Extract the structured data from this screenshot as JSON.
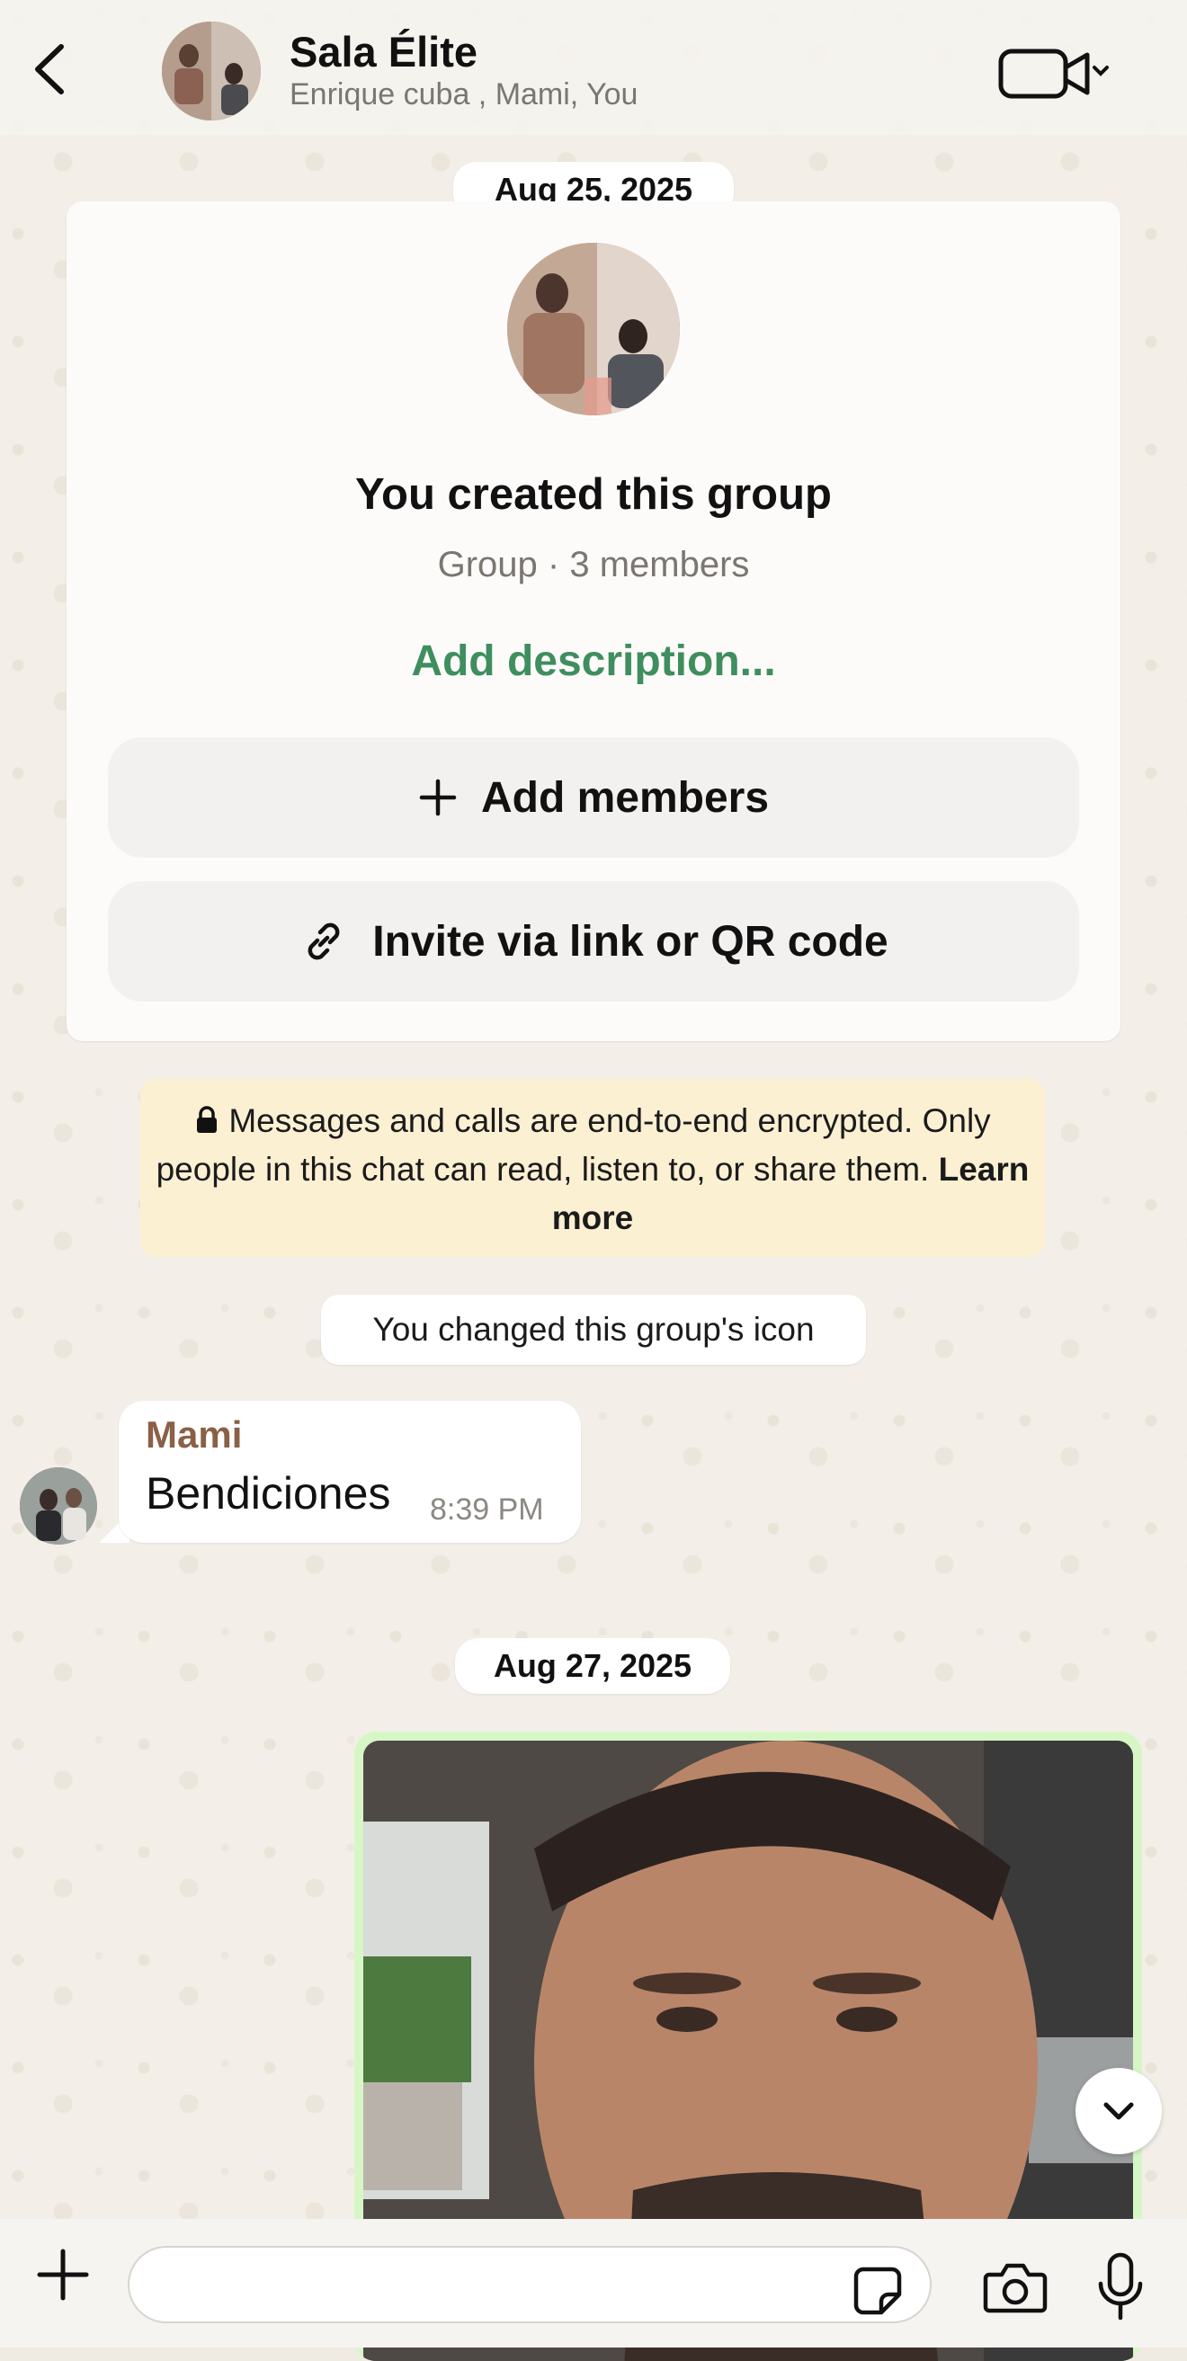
{
  "header": {
    "title": "Sala Élite",
    "subtitle": "Enrique cuba , Mami, You"
  },
  "dates": {
    "first": "Aug 25, 2025",
    "second": "Aug 27, 2025"
  },
  "group_card": {
    "title": "You created this group",
    "subtitle": "Group · 3 members",
    "description_link": "Add description...",
    "add_members_label": "Add members",
    "invite_label": "Invite via link or QR code"
  },
  "encryption_notice": {
    "text": "Messages and calls are end-to-end encrypted. Only people in this chat can read, listen to, or share them.",
    "learn_more": "Learn more"
  },
  "system_message": "You changed this group's icon",
  "messages": [
    {
      "sender": "Mami",
      "text": "Bendiciones",
      "time": "8:39 PM"
    }
  ],
  "input": {
    "placeholder": ""
  },
  "colors": {
    "accent_green": "#3f8e5e",
    "sender_name": "#8a6046",
    "outgoing_bubble": "#d6f7c5",
    "encryption_bg": "#fcf0d3"
  },
  "icons": {
    "back": "chevron-left-icon",
    "video": "video-camera-icon",
    "add": "plus-icon",
    "link": "link-icon",
    "lock": "lock-icon",
    "scroll": "chevron-down-icon",
    "sticker": "sticker-icon",
    "camera": "camera-icon",
    "mic": "microphone-icon"
  }
}
